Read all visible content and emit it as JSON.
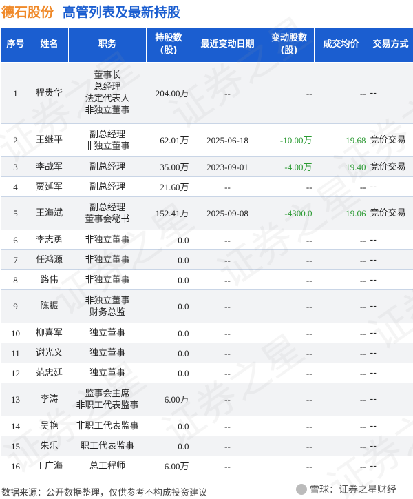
{
  "header": {
    "company": "德石股份",
    "title": "高管列表及最新持股"
  },
  "table": {
    "columns": [
      "序号",
      "姓名",
      "职务",
      "持股数\n(股)",
      "最近变动日期",
      "变动股数\n(股)",
      "成交均价",
      "交易方式"
    ],
    "rows": [
      {
        "idx": "1",
        "name": "程贵华",
        "position": "董事长\n总经理\n法定代表人\n非独立董事",
        "holding": "204.00万",
        "date": "--",
        "change": "--",
        "price": "--",
        "type": "--"
      },
      {
        "idx": "2",
        "name": "王继平",
        "position": "副总经理\n非独立董事",
        "holding": "62.01万",
        "date": "2025-06-18",
        "change": "-10.00万",
        "price": "19.68",
        "type": "竞价交易"
      },
      {
        "idx": "3",
        "name": "李战军",
        "position": "副总经理",
        "holding": "35.00万",
        "date": "2023-09-01",
        "change": "-4.00万",
        "price": "19.40",
        "type": "竞价交易"
      },
      {
        "idx": "4",
        "name": "贾延军",
        "position": "副总经理",
        "holding": "21.60万",
        "date": "--",
        "change": "--",
        "price": "--",
        "type": "--"
      },
      {
        "idx": "5",
        "name": "王海斌",
        "position": "副总经理\n董事会秘书",
        "holding": "152.41万",
        "date": "2025-09-08",
        "change": "-4300.0",
        "price": "19.06",
        "type": "竞价交易"
      },
      {
        "idx": "6",
        "name": "李志勇",
        "position": "非独立董事",
        "holding": "0.0",
        "date": "--",
        "change": "--",
        "price": "--",
        "type": "--"
      },
      {
        "idx": "7",
        "name": "任鸿源",
        "position": "非独立董事",
        "holding": "0.0",
        "date": "--",
        "change": "--",
        "price": "--",
        "type": "--"
      },
      {
        "idx": "8",
        "name": "路伟",
        "position": "非独立董事",
        "holding": "0.0",
        "date": "--",
        "change": "--",
        "price": "--",
        "type": "--"
      },
      {
        "idx": "9",
        "name": "陈振",
        "position": "非独立董事\n财务总监",
        "holding": "0.0",
        "date": "--",
        "change": "--",
        "price": "--",
        "type": "--"
      },
      {
        "idx": "10",
        "name": "柳喜军",
        "position": "独立董事",
        "holding": "0.0",
        "date": "--",
        "change": "--",
        "price": "--",
        "type": "--"
      },
      {
        "idx": "11",
        "name": "谢光义",
        "position": "独立董事",
        "holding": "0.0",
        "date": "--",
        "change": "--",
        "price": "--",
        "type": "--"
      },
      {
        "idx": "12",
        "name": "范忠廷",
        "position": "独立董事",
        "holding": "0.0",
        "date": "--",
        "change": "--",
        "price": "--",
        "type": "--"
      },
      {
        "idx": "13",
        "name": "李涛",
        "position": "监事会主席\n非职工代表监事",
        "holding": "6.00万",
        "date": "--",
        "change": "--",
        "price": "--",
        "type": "--"
      },
      {
        "idx": "14",
        "name": "吴艳",
        "position": "非职工代表监事",
        "holding": "0.0",
        "date": "--",
        "change": "--",
        "price": "--",
        "type": "--"
      },
      {
        "idx": "15",
        "name": "朱乐",
        "position": "职工代表监事",
        "holding": "0.0",
        "date": "--",
        "change": "--",
        "price": "--",
        "type": "--"
      },
      {
        "idx": "16",
        "name": "于广海",
        "position": "总工程师",
        "holding": "6.00万",
        "date": "--",
        "change": "--",
        "price": "--",
        "type": "--"
      }
    ]
  },
  "footer": {
    "source": "数据来源：公开数据整理，仅供参考不构成投资建议",
    "brand": "雪球：证券之星财经"
  },
  "watermark": "证券之星",
  "colors": {
    "header_bg": "#1b5ed0",
    "company": "#f08a2a",
    "title": "#1b5ed0",
    "negative_change": "#2a9a32"
  }
}
